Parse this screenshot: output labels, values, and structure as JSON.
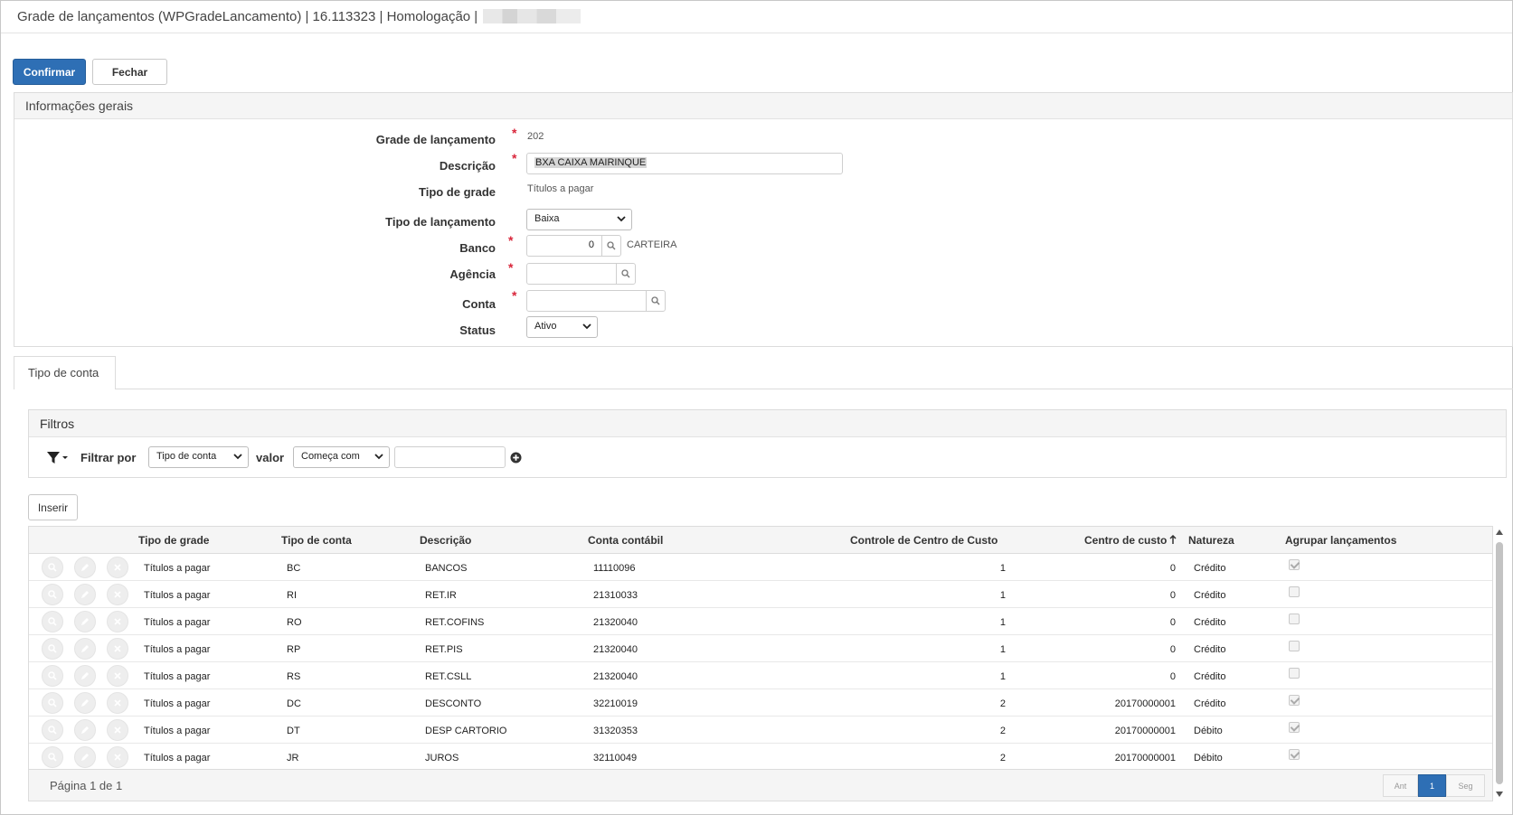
{
  "window": {
    "title": "Grade de lançamentos (WPGradeLancamento) | 16.113323 | Homologação |"
  },
  "toolbar": {
    "confirm_label": "Confirmar",
    "close_label": "Fechar"
  },
  "general": {
    "header": "Informações gerais",
    "fields": {
      "grade": {
        "label": "Grade de lançamento",
        "value": "202"
      },
      "descricao": {
        "label": "Descrição",
        "value": "BXA CAIXA MAIRINQUE"
      },
      "tipo_grade": {
        "label": "Tipo de grade",
        "value": "Títulos a pagar"
      },
      "tipo_lancamento": {
        "label": "Tipo de lançamento",
        "value": "Baixa"
      },
      "banco": {
        "label": "Banco",
        "value": "0",
        "lookup_text": "CARTEIRA"
      },
      "agencia": {
        "label": "Agência",
        "value": ""
      },
      "conta": {
        "label": "Conta",
        "value": ""
      },
      "status": {
        "label": "Status",
        "value": "Ativo"
      }
    }
  },
  "tabs": [
    {
      "label": "Tipo de conta",
      "active": true
    }
  ],
  "filters": {
    "header": "Filtros",
    "filter_by_label": "Filtrar por",
    "field_value": "Tipo de conta",
    "value_label": "valor",
    "operator_value": "Começa com",
    "input_value": ""
  },
  "grid": {
    "insert_label": "Inserir",
    "columns": [
      "Tipo de grade",
      "Tipo de conta",
      "Descrição",
      "Conta contábil",
      "Controle de Centro de Custo",
      "Centro de custo",
      "Natureza",
      "Agrupar lançamentos"
    ],
    "sort_column": "Centro de custo",
    "rows": [
      {
        "tipo_grade": "Títulos a pagar",
        "tipo_conta": "BC",
        "descricao": "BANCOS",
        "conta_contabil": "11110096",
        "controle_cc": "1",
        "centro_custo": "0",
        "natureza": "Crédito",
        "agrupar": true
      },
      {
        "tipo_grade": "Títulos a pagar",
        "tipo_conta": "RI",
        "descricao": "RET.IR",
        "conta_contabil": "21310033",
        "controle_cc": "1",
        "centro_custo": "0",
        "natureza": "Crédito",
        "agrupar": false
      },
      {
        "tipo_grade": "Títulos a pagar",
        "tipo_conta": "RO",
        "descricao": "RET.COFINS",
        "conta_contabil": "21320040",
        "controle_cc": "1",
        "centro_custo": "0",
        "natureza": "Crédito",
        "agrupar": false
      },
      {
        "tipo_grade": "Títulos a pagar",
        "tipo_conta": "RP",
        "descricao": "RET.PIS",
        "conta_contabil": "21320040",
        "controle_cc": "1",
        "centro_custo": "0",
        "natureza": "Crédito",
        "agrupar": false
      },
      {
        "tipo_grade": "Títulos a pagar",
        "tipo_conta": "RS",
        "descricao": "RET.CSLL",
        "conta_contabil": "21320040",
        "controle_cc": "1",
        "centro_custo": "0",
        "natureza": "Crédito",
        "agrupar": false
      },
      {
        "tipo_grade": "Títulos a pagar",
        "tipo_conta": "DC",
        "descricao": "DESCONTO",
        "conta_contabil": "32210019",
        "controle_cc": "2",
        "centro_custo": "20170000001",
        "natureza": "Crédito",
        "agrupar": true
      },
      {
        "tipo_grade": "Títulos a pagar",
        "tipo_conta": "DT",
        "descricao": "DESP CARTORIO",
        "conta_contabil": "31320353",
        "controle_cc": "2",
        "centro_custo": "20170000001",
        "natureza": "Débito",
        "agrupar": true
      },
      {
        "tipo_grade": "Títulos a pagar",
        "tipo_conta": "JR",
        "descricao": "JUROS",
        "conta_contabil": "32110049",
        "controle_cc": "2",
        "centro_custo": "20170000001",
        "natureza": "Débito",
        "agrupar": true
      }
    ],
    "pagination": {
      "text": "Página 1 de 1",
      "prev_label": "Ant",
      "current": "1",
      "next_label": "Seg"
    }
  },
  "colors": {
    "primary": "#2e6fb5",
    "required": "#d9263b",
    "panel_header": "#f5f5f5"
  }
}
